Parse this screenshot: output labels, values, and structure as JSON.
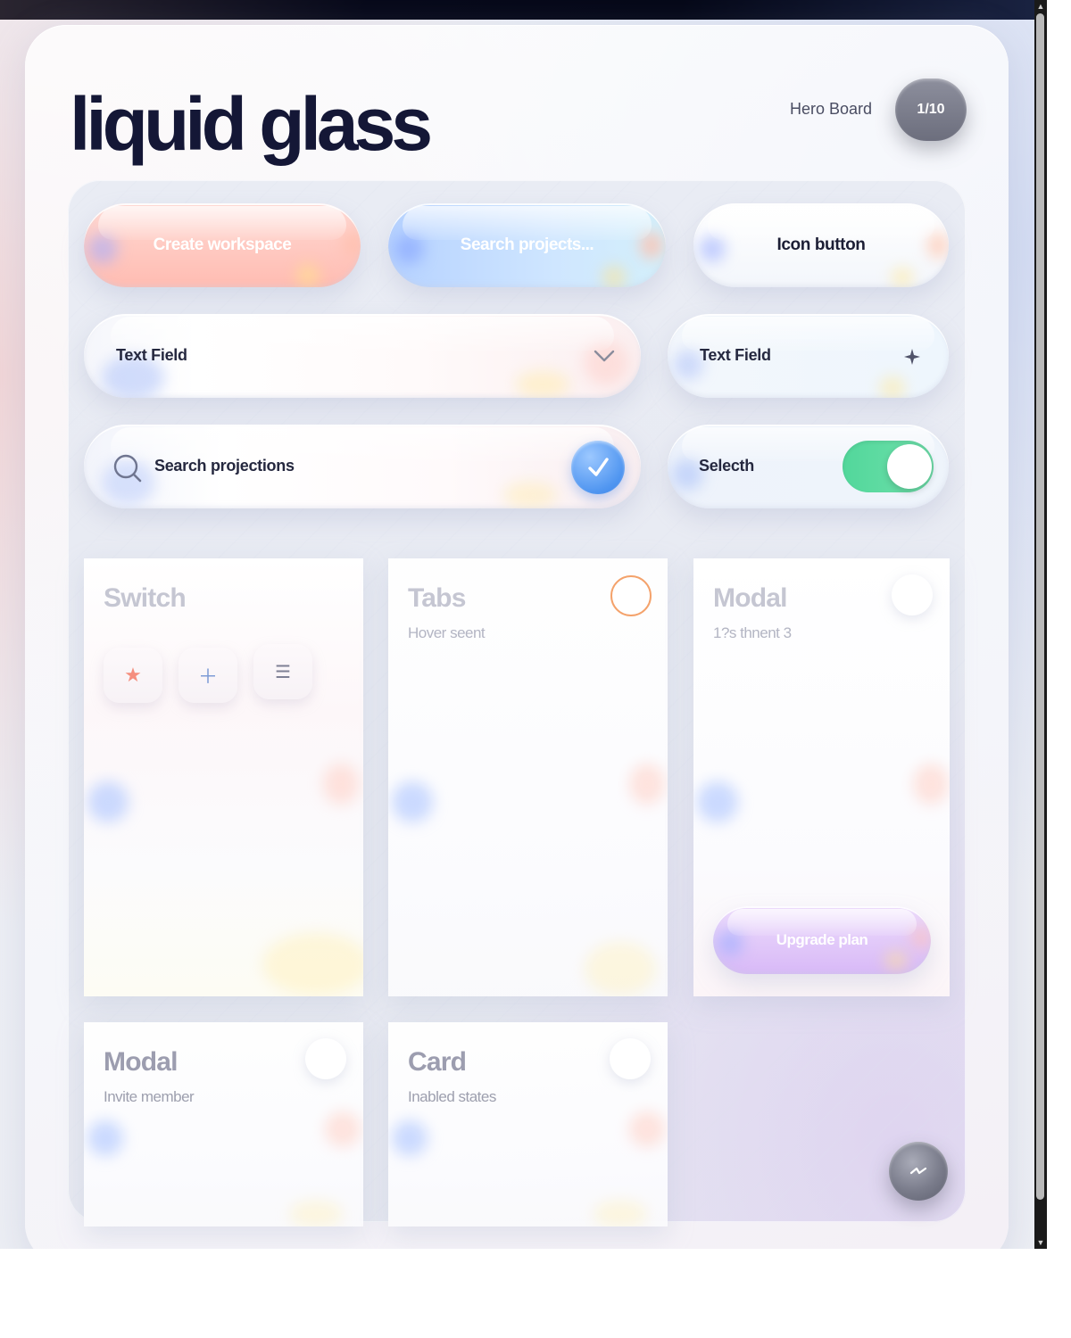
{
  "app": {
    "title": "liquid glass",
    "hero_label": "Hero Board",
    "page_indicator": "1/10"
  },
  "buttons": {
    "create": "Create workspace",
    "search": "Search projects...",
    "icon": "Icon button"
  },
  "fields": {
    "text_field_1": "Text Field",
    "text_field_2": "Text Field",
    "search_value": "Search projections",
    "switch_label": "Selecth",
    "switch_on": true
  },
  "cards": {
    "switch": {
      "title": "Switch",
      "icons": [
        "star-icon",
        "plus-icon",
        "menu-icon"
      ]
    },
    "tabs": {
      "title": "Tabs",
      "subtitle": "Hover seent"
    },
    "modal_1": {
      "title": "Modal",
      "subtitle": "1?s thnent 3",
      "button": "Upgrade plan"
    },
    "modal_2": {
      "title": "Modal",
      "subtitle": "Invite member"
    },
    "card": {
      "title": "Card",
      "subtitle": "Inabled states"
    }
  },
  "colors": {
    "title": "#141736",
    "coral": "#ffbcb2",
    "sky": "#b6d2ff",
    "mint": "#52d79b",
    "lilac": "#d8b9f7",
    "ring": "#f4a26b"
  },
  "icons": {
    "chevron": "chevron-down-icon",
    "sparkle": "sparkle-icon",
    "search": "search-icon",
    "check": "check-icon",
    "fab": "wand-icon"
  }
}
